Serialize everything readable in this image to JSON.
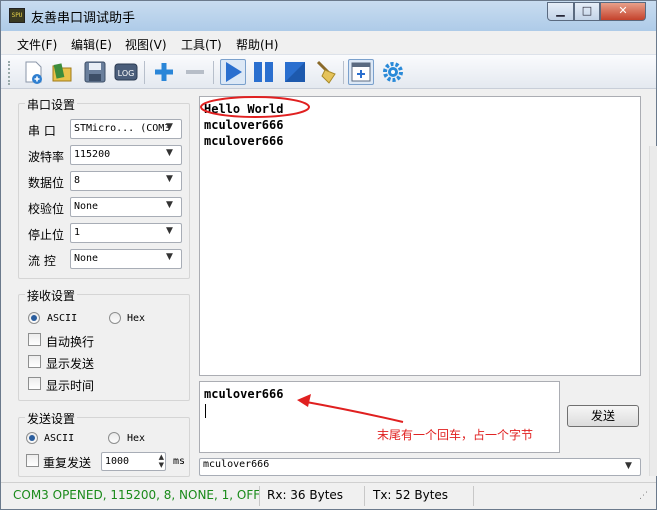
{
  "window": {
    "title": "友善串口调试助手",
    "app_icon_text": "SPU"
  },
  "menu": [
    "文件(F)",
    "编辑(E)",
    "视图(V)",
    "工具(T)",
    "帮助(H)"
  ],
  "toolbar": {
    "buttons": [
      "new-document-icon",
      "open-folder-icon",
      "save-icon",
      "log-icon",
      "add-icon",
      "remove-icon",
      "play-icon",
      "pause-icon",
      "stop-icon",
      "broom-icon",
      "window-icon",
      "gear-icon"
    ],
    "log_label": "LOG"
  },
  "serial_settings": {
    "title": "串口设置",
    "port_label": "串  口",
    "port_value": "STMicro... (COM3",
    "baud_label": "波特率",
    "baud_value": "115200",
    "databits_label": "数据位",
    "databits_value": "8",
    "parity_label": "校验位",
    "parity_value": "None",
    "stopbits_label": "停止位",
    "stopbits_value": "1",
    "flow_label": "流  控",
    "flow_value": "None"
  },
  "receive_settings": {
    "title": "接收设置",
    "ascii_label": "ASCII",
    "hex_label": "Hex",
    "mode_selected": "ASCII",
    "auto_wrap_label": "自动换行",
    "show_send_label": "显示发送",
    "show_time_label": "显示时间"
  },
  "send_settings": {
    "title": "发送设置",
    "ascii_label": "ASCII",
    "hex_label": "Hex",
    "mode_selected": "ASCII",
    "repeat_label": "重复发送",
    "interval_value": "1000",
    "interval_unit": "ms"
  },
  "receive_area": {
    "lines": [
      "Hello World",
      "mculover666",
      "mculover666"
    ]
  },
  "send_area": {
    "text": "mculover666"
  },
  "send_button": "发送",
  "history": {
    "selected": "mculover666"
  },
  "annotation": {
    "text": "末尾有一个回车，占一个字节",
    "color": "#e02020"
  },
  "status": {
    "connection": "COM3 OPENED, 115200, 8, NONE, 1, OFF",
    "rx": "Rx: 36 Bytes",
    "tx": "Tx: 52 Bytes",
    "connection_color": "#1a8a1a"
  }
}
